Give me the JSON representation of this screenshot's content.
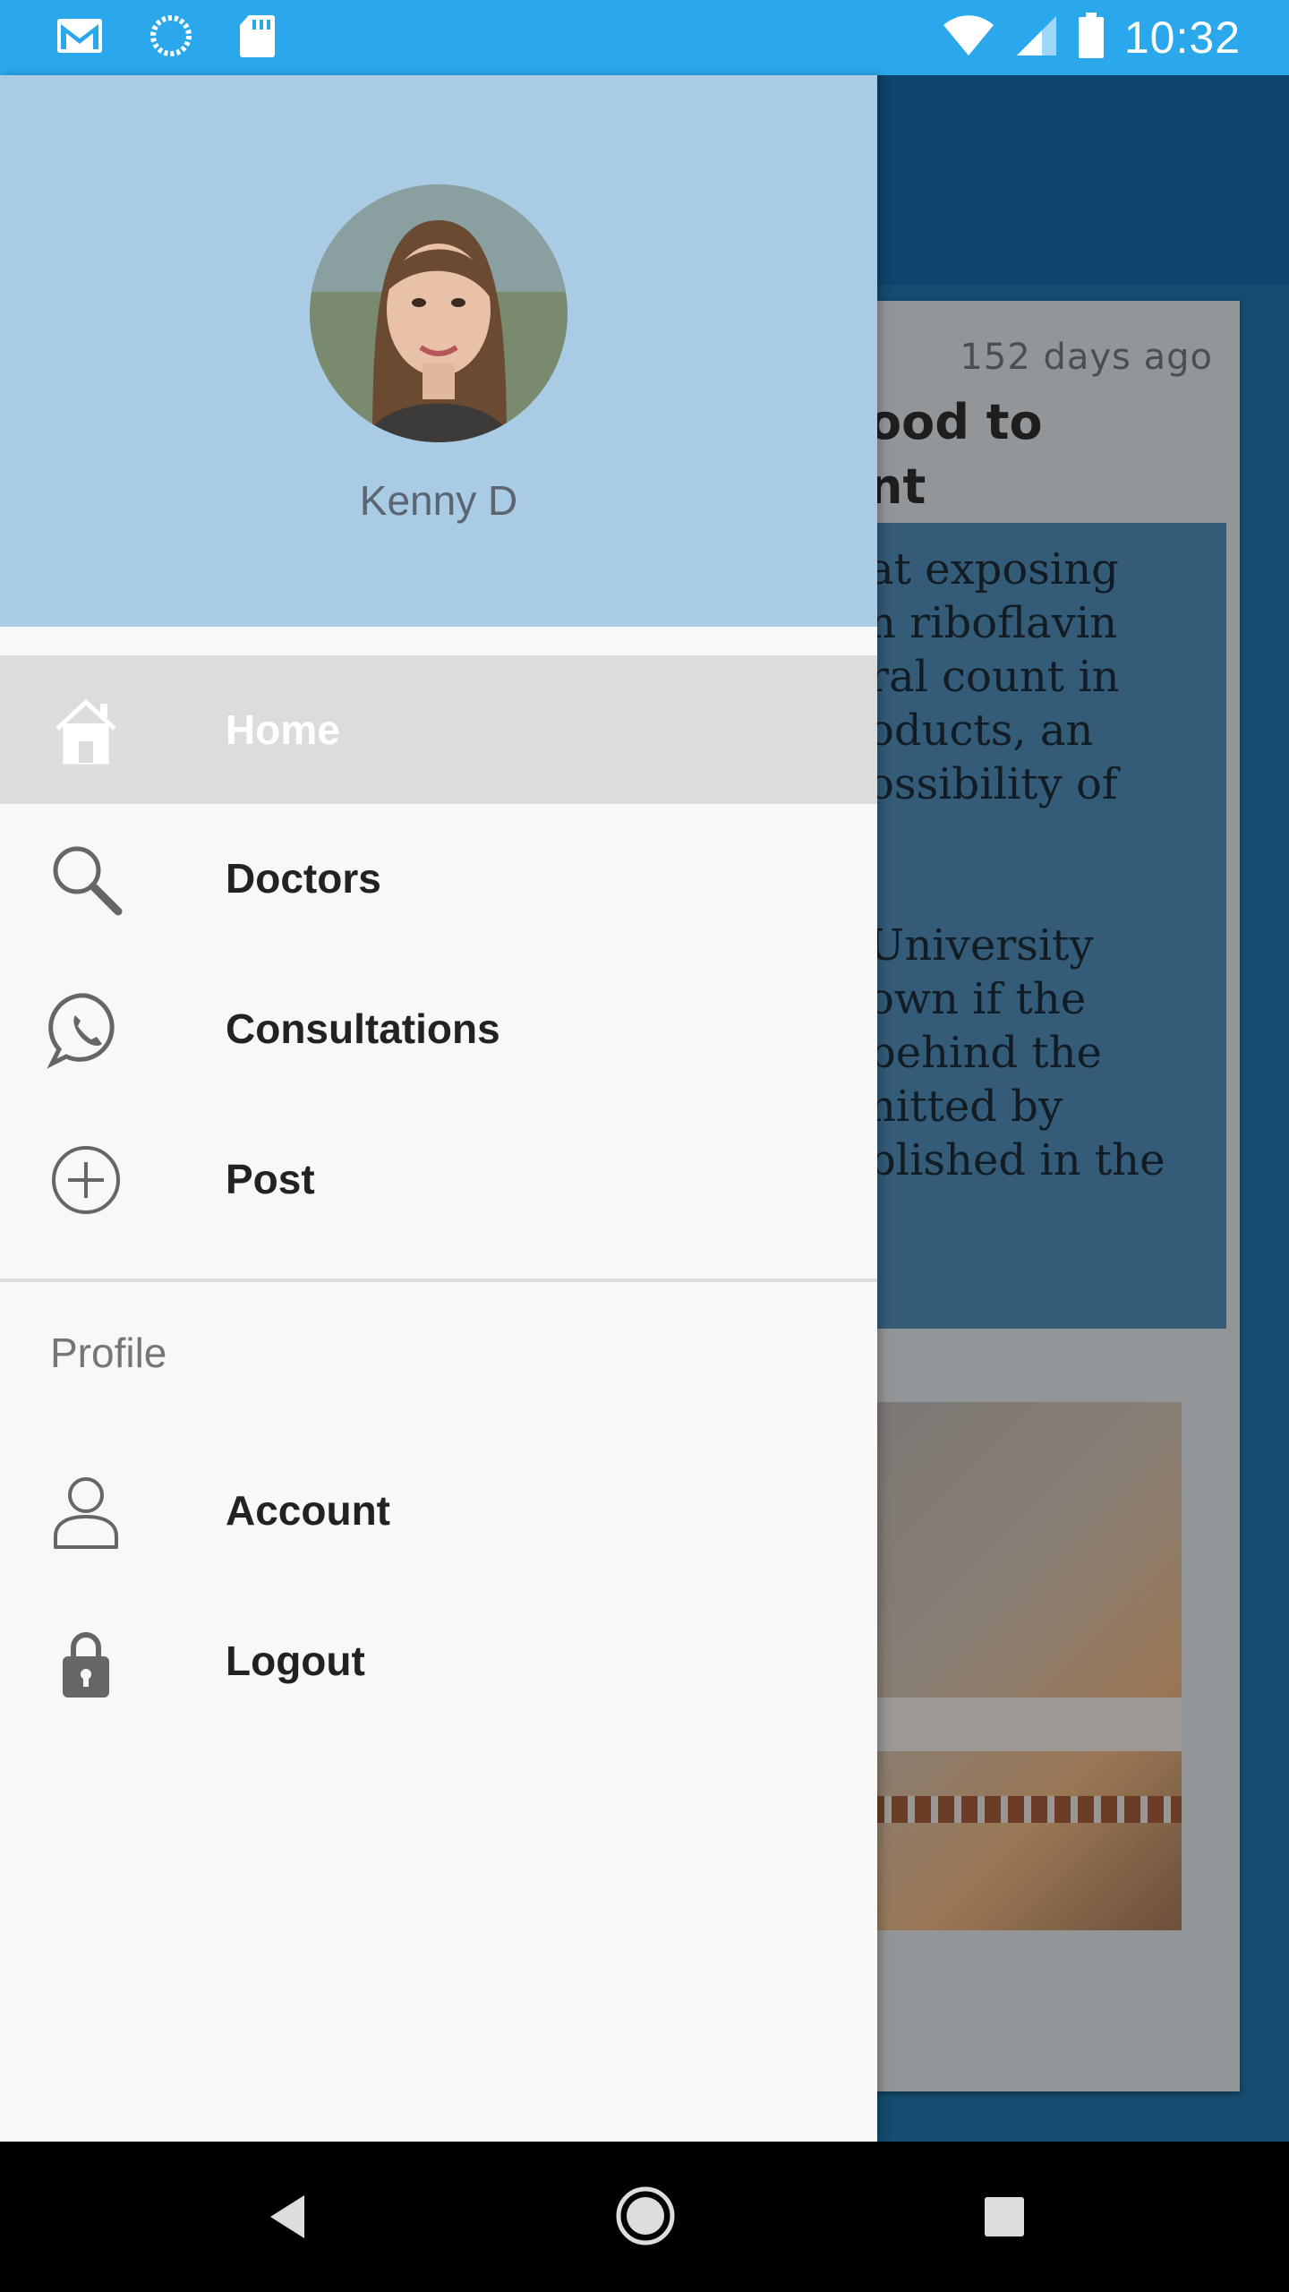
{
  "status_bar": {
    "time": "10:32",
    "icons": [
      "gmail-icon",
      "sync-icon",
      "sd-card-icon",
      "wifi-icon",
      "signal-icon",
      "battery-icon"
    ]
  },
  "background_card": {
    "time_ago": "152 days ago",
    "title_lines": [
      "ood to",
      "nt"
    ],
    "body_lines_1": [
      "at exposing",
      "n riboflavin",
      "ral count in",
      "oducts, an",
      "ossibility of"
    ],
    "body_lines_2": [
      "University",
      "own if the",
      "behind the",
      "nitted by",
      "blished in the"
    ]
  },
  "drawer": {
    "header": {
      "user_name": "Kenny D",
      "background_color": "#a9cbe3"
    },
    "items": [
      {
        "label": "Home",
        "icon": "home-icon",
        "selected": true
      },
      {
        "label": "Doctors",
        "icon": "search-icon",
        "selected": false
      },
      {
        "label": "Consultations",
        "icon": "whatsapp-icon",
        "selected": false
      },
      {
        "label": "Post",
        "icon": "add-circle-icon",
        "selected": false
      }
    ],
    "section_title": "Profile",
    "profile_items": [
      {
        "label": "Account",
        "icon": "person-icon"
      },
      {
        "label": "Logout",
        "icon": "lock-icon"
      }
    ]
  },
  "colors": {
    "status_bar": "#2ba8ec",
    "app_primary": "#1565a0",
    "selected_item_bg": "#dcdcdc"
  }
}
